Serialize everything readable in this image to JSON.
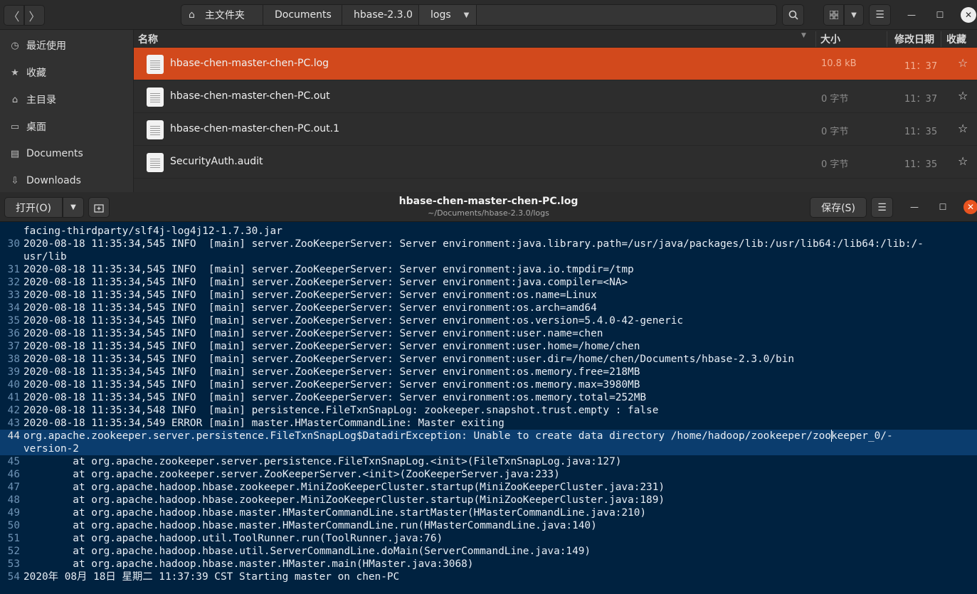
{
  "file_manager": {
    "nav": {
      "back_icon": "chevron-left-icon",
      "forward_icon": "chevron-right-icon"
    },
    "path": [
      "主文件夹",
      "Documents",
      "hbase-2.3.0",
      "logs"
    ],
    "sidebar": [
      {
        "label": "最近使用",
        "icon": "clock-icon"
      },
      {
        "label": "收藏",
        "icon": "star-icon"
      },
      {
        "label": "主目录",
        "icon": "home-icon"
      },
      {
        "label": "桌面",
        "icon": "desktop-icon"
      },
      {
        "label": "Documents",
        "icon": "document-icon"
      },
      {
        "label": "Downloads",
        "icon": "download-icon"
      }
    ],
    "columns": {
      "name": "名称",
      "size": "大小",
      "modified": "修改日期",
      "starred": "收藏"
    },
    "files": [
      {
        "name": "hbase-chen-master-chen-PC.log",
        "size": "10.8 kB",
        "modified": "11：37",
        "selected": true
      },
      {
        "name": "hbase-chen-master-chen-PC.out",
        "size": "0 字节",
        "modified": "11：37",
        "selected": false
      },
      {
        "name": "hbase-chen-master-chen-PC.out.1",
        "size": "0 字节",
        "modified": "11：35",
        "selected": false
      },
      {
        "name": "SecurityAuth.audit",
        "size": "0 字节",
        "modified": "11：35",
        "selected": false
      }
    ]
  },
  "editor": {
    "open_label": "打开(O)",
    "save_label": "保存(S)",
    "title": "hbase-chen-master-chen-PC.log",
    "subtitle": "~/Documents/hbase-2.3.0/logs",
    "current_line": "44",
    "lines": [
      {
        "num": "",
        "text": "facing-thirdparty/slf4j-log4j12-1.7.30.jar"
      },
      {
        "num": "30",
        "text": "2020-08-18 11:35:34,545 INFO  [main] server.ZooKeeperServer: Server environment:java.library.path=/usr/java/packages/lib:/usr/lib64:/lib64:/lib:/-"
      },
      {
        "num": "",
        "text": "usr/lib"
      },
      {
        "num": "31",
        "text": "2020-08-18 11:35:34,545 INFO  [main] server.ZooKeeperServer: Server environment:java.io.tmpdir=/tmp"
      },
      {
        "num": "32",
        "text": "2020-08-18 11:35:34,545 INFO  [main] server.ZooKeeperServer: Server environment:java.compiler=<NA>"
      },
      {
        "num": "33",
        "text": "2020-08-18 11:35:34,545 INFO  [main] server.ZooKeeperServer: Server environment:os.name=Linux"
      },
      {
        "num": "34",
        "text": "2020-08-18 11:35:34,545 INFO  [main] server.ZooKeeperServer: Server environment:os.arch=amd64"
      },
      {
        "num": "35",
        "text": "2020-08-18 11:35:34,545 INFO  [main] server.ZooKeeperServer: Server environment:os.version=5.4.0-42-generic"
      },
      {
        "num": "36",
        "text": "2020-08-18 11:35:34,545 INFO  [main] server.ZooKeeperServer: Server environment:user.name=chen"
      },
      {
        "num": "37",
        "text": "2020-08-18 11:35:34,545 INFO  [main] server.ZooKeeperServer: Server environment:user.home=/home/chen"
      },
      {
        "num": "38",
        "text": "2020-08-18 11:35:34,545 INFO  [main] server.ZooKeeperServer: Server environment:user.dir=/home/chen/Documents/hbase-2.3.0/bin"
      },
      {
        "num": "39",
        "text": "2020-08-18 11:35:34,545 INFO  [main] server.ZooKeeperServer: Server environment:os.memory.free=218MB"
      },
      {
        "num": "40",
        "text": "2020-08-18 11:35:34,545 INFO  [main] server.ZooKeeperServer: Server environment:os.memory.max=3980MB"
      },
      {
        "num": "41",
        "text": "2020-08-18 11:35:34,545 INFO  [main] server.ZooKeeperServer: Server environment:os.memory.total=252MB"
      },
      {
        "num": "42",
        "text": "2020-08-18 11:35:34,548 INFO  [main] persistence.FileTxnSnapLog: zookeeper.snapshot.trust.empty : false"
      },
      {
        "num": "43",
        "text": "2020-08-18 11:35:34,549 ERROR [main] master.HMasterCommandLine: Master exiting"
      },
      {
        "num": "44",
        "text": "org.apache.zookeeper.server.persistence.FileTxnSnapLog$DatadirException: Unable to create data directory /home/hadoop/zookeeper/zookeeper_0/-"
      },
      {
        "num": "",
        "text": "version-2"
      },
      {
        "num": "45",
        "text": "        at org.apache.zookeeper.server.persistence.FileTxnSnapLog.<init>(FileTxnSnapLog.java:127)"
      },
      {
        "num": "46",
        "text": "        at org.apache.zookeeper.server.ZooKeeperServer.<init>(ZooKeeperServer.java:233)"
      },
      {
        "num": "47",
        "text": "        at org.apache.hadoop.hbase.zookeeper.MiniZooKeeperCluster.startup(MiniZooKeeperCluster.java:231)"
      },
      {
        "num": "48",
        "text": "        at org.apache.hadoop.hbase.zookeeper.MiniZooKeeperCluster.startup(MiniZooKeeperCluster.java:189)"
      },
      {
        "num": "49",
        "text": "        at org.apache.hadoop.hbase.master.HMasterCommandLine.startMaster(HMasterCommandLine.java:210)"
      },
      {
        "num": "50",
        "text": "        at org.apache.hadoop.hbase.master.HMasterCommandLine.run(HMasterCommandLine.java:140)"
      },
      {
        "num": "51",
        "text": "        at org.apache.hadoop.util.ToolRunner.run(ToolRunner.java:76)"
      },
      {
        "num": "52",
        "text": "        at org.apache.hadoop.hbase.util.ServerCommandLine.doMain(ServerCommandLine.java:149)"
      },
      {
        "num": "53",
        "text": "        at org.apache.hadoop.hbase.master.HMaster.main(HMaster.java:3068)"
      },
      {
        "num": "54",
        "text": "2020年 08月 18日 星期二 11:37:39 CST Starting master on chen-PC"
      }
    ]
  },
  "colors": {
    "selection": "#d2491c",
    "editor_bg": "#002240",
    "current_line": "#0b3d6e",
    "close_accent": "#e95420"
  }
}
